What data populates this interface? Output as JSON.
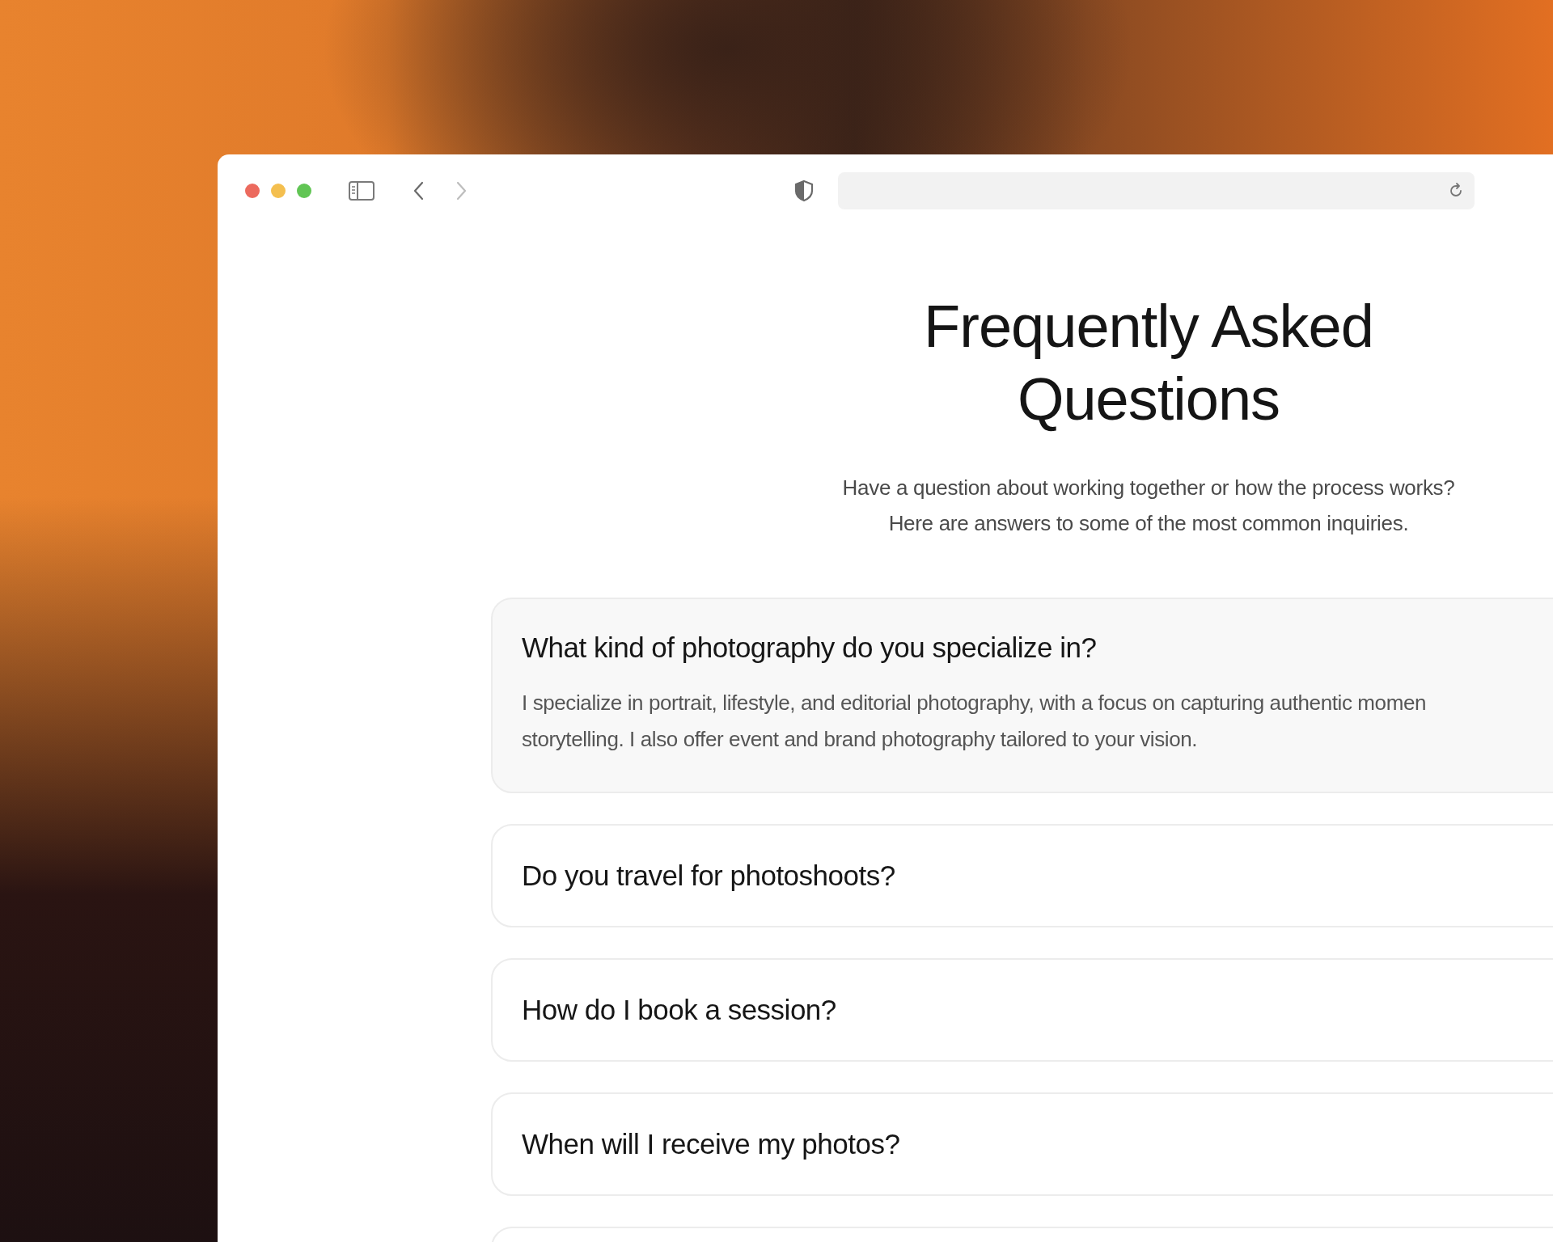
{
  "heading": {
    "title": [
      "Frequently Asked",
      "Questions"
    ],
    "subtitle": [
      "Have a question about working together or how the process works?",
      "Here are answers to some of the most common inquiries."
    ]
  },
  "faq": [
    {
      "question": "What kind of photography do you specialize in?",
      "expanded": true,
      "answer": [
        "I specialize in portrait, lifestyle, and editorial photography, with a focus on capturing authentic momen",
        "storytelling. I also offer event and brand photography tailored to your vision."
      ]
    },
    {
      "question": "Do you travel for photoshoots?",
      "expanded": false
    },
    {
      "question": "How do I book a session?",
      "expanded": false
    },
    {
      "question": "When will I receive my photos?",
      "expanded": false
    }
  ]
}
